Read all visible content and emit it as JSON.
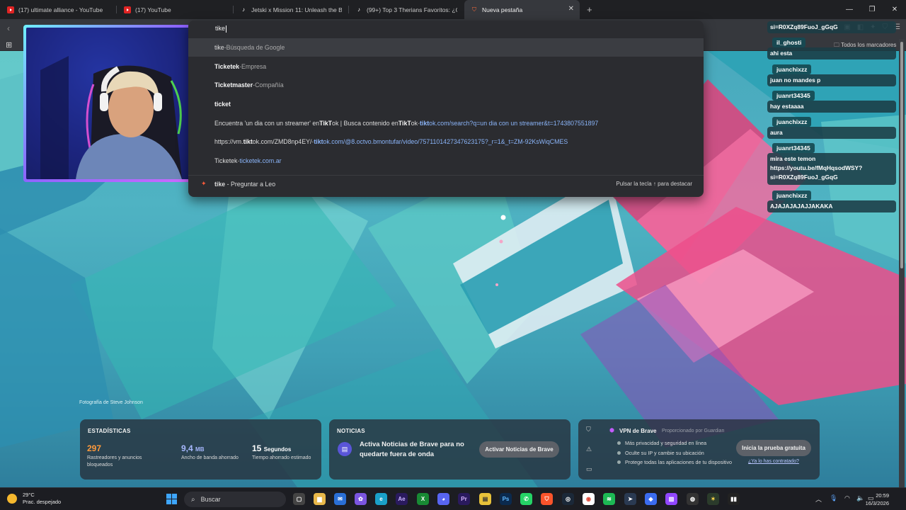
{
  "tabs": [
    {
      "title": "(17) ultimate alliance - YouTube",
      "icon": "youtube-icon"
    },
    {
      "title": "(17) YouTube",
      "icon": "youtube-icon"
    },
    {
      "title": "Jetski x Mission 11: Unleash the Beat",
      "icon": "tiktok-icon"
    },
    {
      "title": "(99+) Top 3 Therians Favoritos: ¿Cuál",
      "icon": "tiktok-icon"
    },
    {
      "title": "Nueva pestaña",
      "icon": "brave-icon",
      "active": true
    }
  ],
  "bookmarks": {
    "all_label": "Todos los marcadores"
  },
  "omnibox": {
    "query": "tike",
    "suggestions": [
      {
        "main": "tike",
        "sep": " - ",
        "detail": "Búsqueda de Google",
        "selected": true
      },
      {
        "main": "Ticketek",
        "sep": " - ",
        "detail": "Empresa"
      },
      {
        "main": "Ticketmaster",
        "sep": " - ",
        "detail": "Compañía"
      },
      {
        "main": "ticket",
        "sep": "",
        "detail": ""
      },
      {
        "pre": "Encuentra 'un dia con un streamer' en ",
        "bold1": "TikT",
        "mid": "ok | Busca contenido en ",
        "bold2": "TikT",
        "post": "ok",
        "sep": " - ",
        "url_bold": "tikt",
        "url": "ok.com/search?q=un dia con un streamer&t=1743807551897"
      },
      {
        "pre": "https://vm.",
        "bold1": "tikt",
        "mid": "ok.com/ZMD8np4EY/",
        "bold2": "",
        "post": "",
        "sep": " - ",
        "url_bold": "tikt",
        "url": "ok.com/@8.octvo.bmontufar/video/7571101427347623175?_r=1&_t=ZM-92KsWiqCMES"
      },
      {
        "main_plain": "Ticketek",
        "sep": " - ",
        "url": "ticketek.com.ar"
      }
    ],
    "leo": {
      "query": "tike",
      "label": "Preguntar a Leo",
      "hint": "Pulsar la tecla ↑ para destacar"
    }
  },
  "chat": [
    {
      "type": "msg",
      "text": "si=R0XZq89FuoJ_gGqG"
    },
    {
      "type": "user",
      "text": "il_ghosti"
    },
    {
      "type": "msg",
      "text": "ahi esta"
    },
    {
      "type": "user",
      "text": "juanchixzz"
    },
    {
      "type": "msg",
      "text": "juan no mandes p"
    },
    {
      "type": "user",
      "text": "juanrt34345"
    },
    {
      "type": "msg",
      "text": "hay estaaaa"
    },
    {
      "type": "user",
      "text": "juanchixzz"
    },
    {
      "type": "msg",
      "text": "aura"
    },
    {
      "type": "user",
      "text": "juanrt34345"
    },
    {
      "type": "msg",
      "text": "mira este temon"
    },
    {
      "type": "msg",
      "text": "https://youtu.be/fMqHqsodWSY?"
    },
    {
      "type": "msg",
      "text": "si=R0XZq89FuoJ_gGqG"
    },
    {
      "type": "user",
      "text": "juanchixzz"
    },
    {
      "type": "msg",
      "text": "AJAJAJAJAJJAKAKA"
    }
  ],
  "photo_credit": "Fotografía de Steve Johnson",
  "stats": {
    "heading": "ESTADÍSTICAS",
    "items": [
      {
        "value": "297",
        "unit": "",
        "label": "Rastreadores y anuncios bloqueados",
        "color": "#ff9a3c"
      },
      {
        "value": "9,4",
        "unit": "MB",
        "label": "Ancho de banda ahorrado",
        "color": "#a8b9ff"
      },
      {
        "value": "15",
        "unit": "Segundos",
        "label": "Tiempo ahorrado estimado",
        "color": "#ffffff"
      }
    ]
  },
  "news": {
    "heading": "NOTICIAS",
    "text": "Activa Noticias de Brave para no quedarte fuera de onda",
    "button": "Activar Noticias de Brave"
  },
  "vpn": {
    "title": "VPN de Brave",
    "provider": "Proporcionado por  Guardian",
    "features": [
      "Más privacidad y seguridad en línea",
      "Oculte su IP y cambie su ubicación",
      "Protege todas las aplicaciones de tu dispositivo"
    ],
    "button": "Inicia la prueba gratuita",
    "link": "¿Ya lo has contratado?"
  },
  "taskbar": {
    "weather_temp": "29°C",
    "weather_desc": "Prac. despejado",
    "search_placeholder": "Buscar",
    "time": "20:59",
    "date": "16/3/2026"
  }
}
